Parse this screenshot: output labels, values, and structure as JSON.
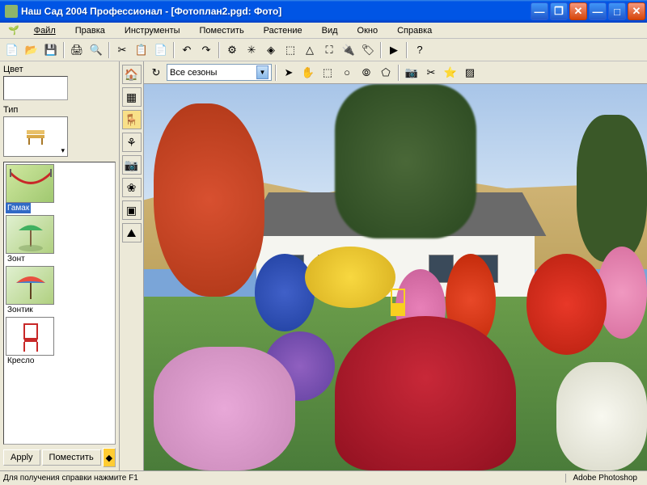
{
  "window": {
    "title": "Наш Сад 2004 Профессионал - [Фотоплан2.pgd: Фото]"
  },
  "menu": {
    "file": "Файл",
    "edit": "Правка",
    "tools": "Инструменты",
    "place": "Поместить",
    "plant": "Растение",
    "view": "Вид",
    "window": "Окно",
    "help": "Справка"
  },
  "leftpanel": {
    "color_label": "Цвет",
    "type_label": "Тип",
    "items": [
      {
        "label": "Гамак"
      },
      {
        "label": "Зонт"
      },
      {
        "label": "Зонтик"
      },
      {
        "label": "Кресло"
      }
    ],
    "apply_btn": "Apply",
    "place_btn": "Поместить"
  },
  "viewbar": {
    "season_value": "Все сезоны"
  },
  "status": {
    "help": "Для получения справки нажмите F1",
    "external": "Adobe Photoshop"
  },
  "icons": {
    "house": "house-icon",
    "fence": "fence-icon",
    "plant3d": "plant3d-icon",
    "groups": "groups-icon",
    "camera": "camera-icon",
    "flower": "flower-icon",
    "album": "album-icon",
    "terrain": "terrain-icon"
  }
}
